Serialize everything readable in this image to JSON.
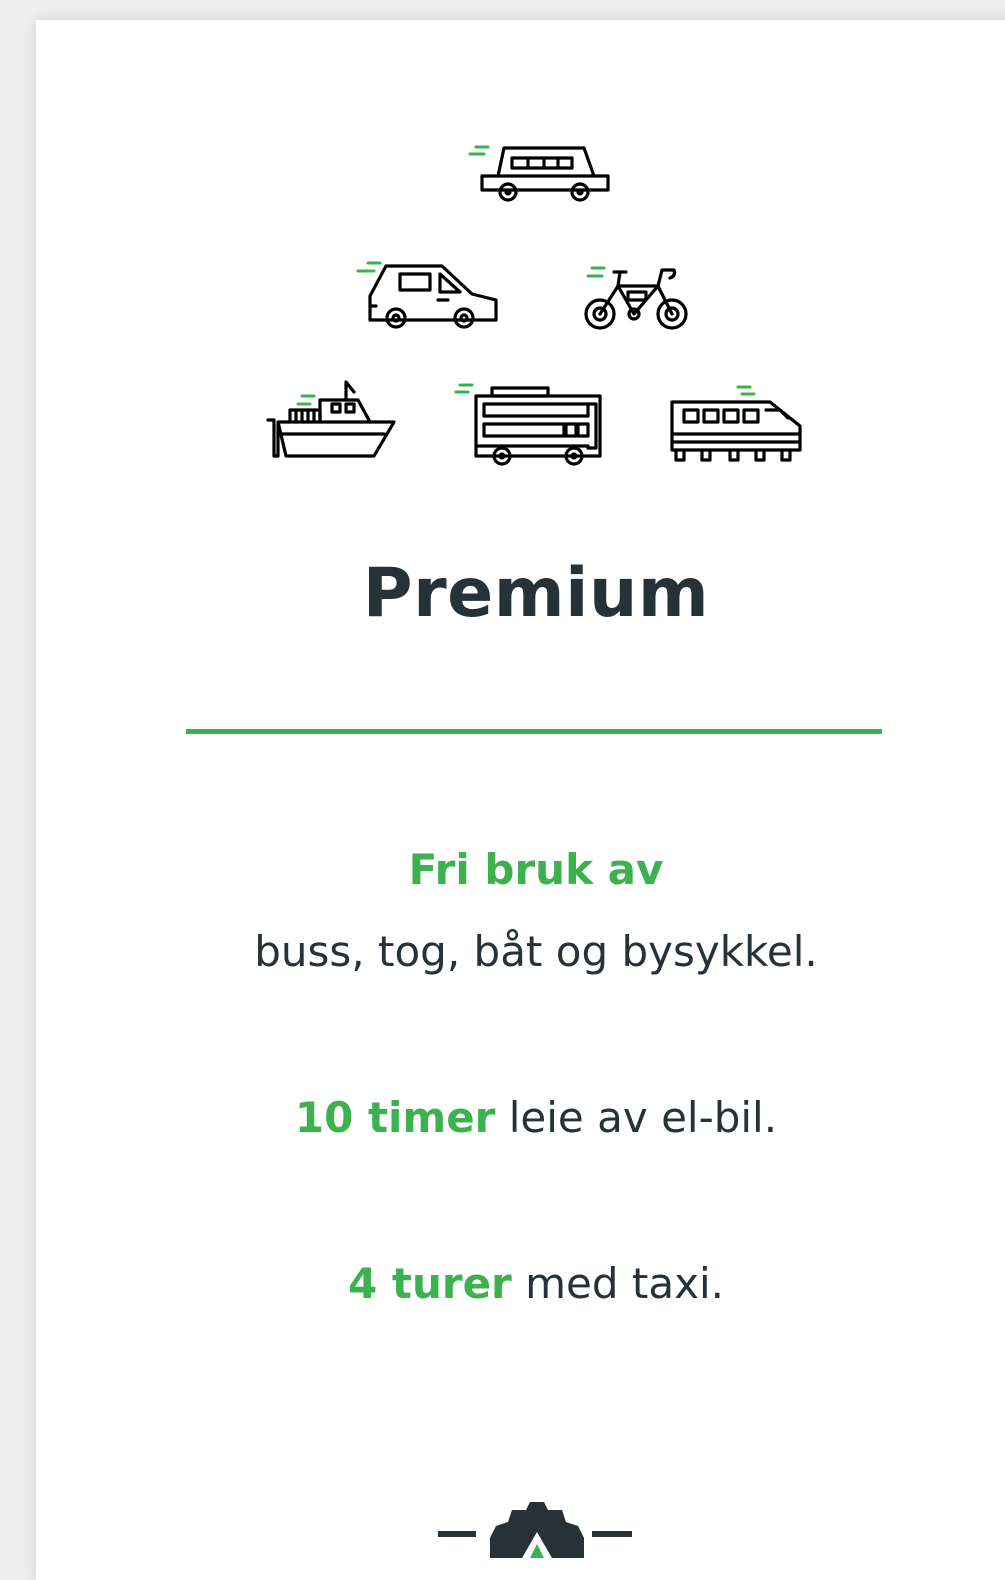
{
  "plan": {
    "title": "Premium",
    "accent_color": "#3cb24f",
    "text_color": "#263238"
  },
  "icons": [
    {
      "name": "limousine-icon"
    },
    {
      "name": "car-icon"
    },
    {
      "name": "bicycle-icon"
    },
    {
      "name": "boat-icon"
    },
    {
      "name": "bus-icon"
    },
    {
      "name": "train-icon"
    }
  ],
  "features": {
    "free_use_heading": "Fri bruk av",
    "free_use_text": "buss, tog, båt og bysykkel.",
    "ev_highlight": "10 timer",
    "ev_text": " leie av el-bil.",
    "taxi_highlight": "4 turer",
    "taxi_text": " med taxi."
  },
  "footer_icon": "gear-icon"
}
